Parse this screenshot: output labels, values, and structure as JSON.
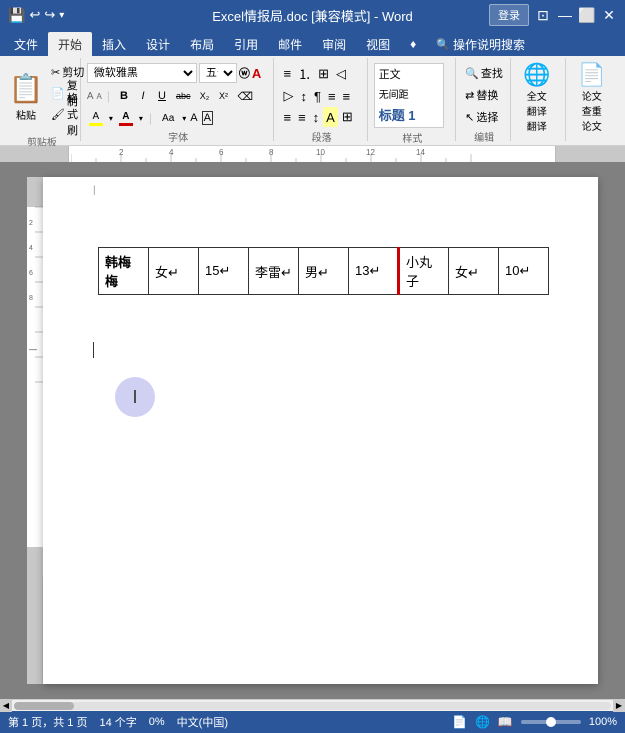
{
  "titlebar": {
    "title": "Excel情报局.doc [兼容模式] - Word",
    "login_label": "登录",
    "icons": {
      "save": "💾",
      "undo": "↩",
      "redo": "↪",
      "dropdown": "▾"
    },
    "window_buttons": [
      "—",
      "⬜",
      "✕"
    ]
  },
  "ribbon": {
    "tabs": [
      "文件",
      "开始",
      "插入",
      "设计",
      "布局",
      "引用",
      "邮件",
      "审阅",
      "视图",
      "♦",
      "操作说明搜索"
    ],
    "active_tab": "开始",
    "groups": {
      "clipboard": {
        "label": "剪贴板",
        "paste_label": "粘贴",
        "cut_label": "剪切",
        "copy_label": "复制",
        "format_painter_label": "格式刷"
      },
      "font": {
        "label": "字体",
        "font_name": "微软雅黑",
        "font_size": "五号",
        "expand_icon": "A",
        "wubi_icon": "Ⓦ",
        "bold": "B",
        "italic": "I",
        "underline": "U",
        "strikethrough": "abc",
        "subscript": "X₂",
        "superscript": "X²",
        "clear_format": "⌫",
        "highlight_color": "A",
        "font_color": "A",
        "font_aa": "Aa",
        "grow": "A",
        "shrink": "A"
      },
      "paragraph": {
        "label": "段落"
      },
      "styles": {
        "label": "样式"
      },
      "edit": {
        "label": "编辑"
      },
      "translate": {
        "label1": "全文",
        "label2": "翻译",
        "label3": "翻译"
      },
      "paper": {
        "label1": "论文",
        "label2": "查重",
        "label3": "论文"
      }
    }
  },
  "document": {
    "table": {
      "rows": [
        [
          "韩梅\n梅",
          "女↵",
          "15↵",
          "李雷↵",
          "男↵",
          "13↵",
          "小丸\n子",
          "女↵",
          "10↵"
        ]
      ]
    }
  },
  "statusbar": {
    "page_info": "第 1 页，共 1 页",
    "word_count": "14 个字",
    "track_changes": "0%",
    "language": "中文(中国)",
    "zoom_level": "100%"
  }
}
